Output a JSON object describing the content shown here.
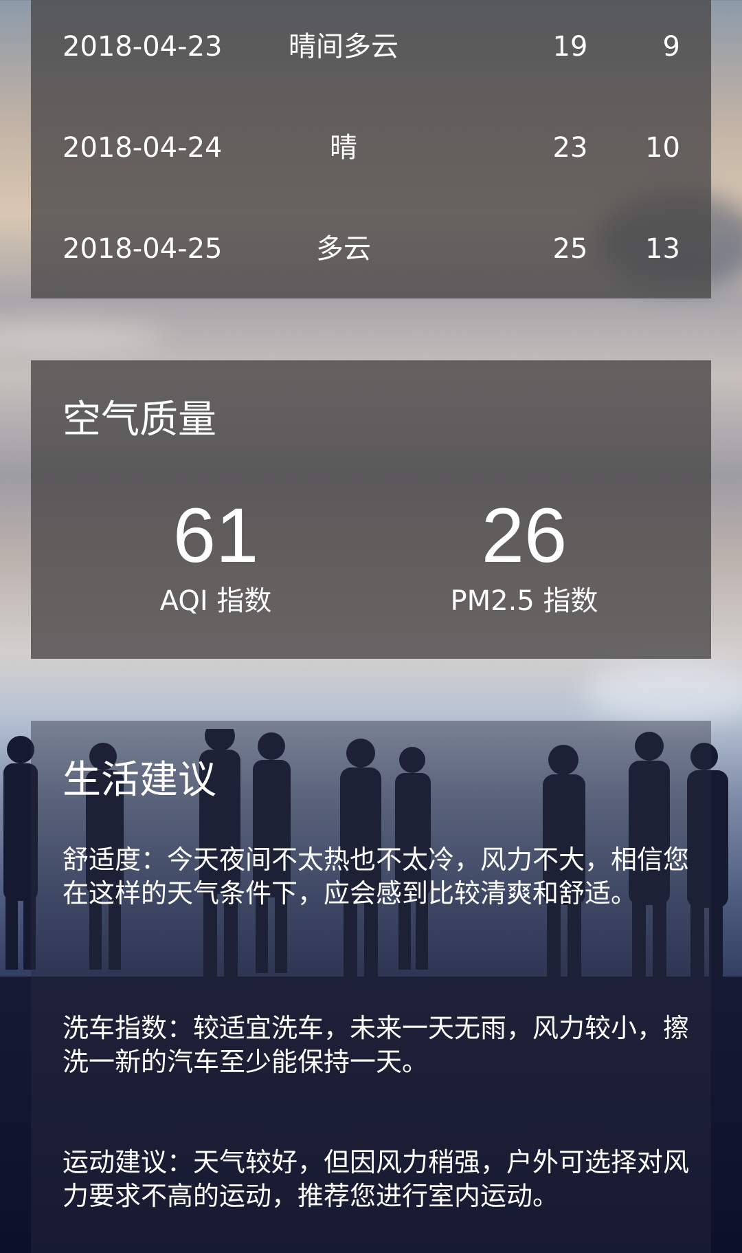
{
  "forecast": {
    "rows": [
      {
        "date": "2018-04-23",
        "condition": "晴间多云",
        "max": "19",
        "min": "9"
      },
      {
        "date": "2018-04-24",
        "condition": "晴",
        "max": "23",
        "min": "10"
      },
      {
        "date": "2018-04-25",
        "condition": "多云",
        "max": "25",
        "min": "13"
      }
    ]
  },
  "air_quality": {
    "title": "空气质量",
    "aqi": {
      "value": "61",
      "label": "AQI 指数"
    },
    "pm25": {
      "value": "26",
      "label": "PM2.5 指数"
    }
  },
  "suggestion": {
    "title": "生活建议",
    "comfort": "舒适度：今天夜间不太热也不太冷，风力不大，相信您在这样的天气条件下，应会感到比较清爽和舒适。",
    "car_wash": "洗车指数：较适宜洗车，未来一天无雨，风力较小，擦洗一新的汽车至少能保持一天。",
    "sport": "运动建议：天气较好，但因风力稍强，户外可选择对风力要求不高的运动，推荐您进行室内运动。"
  }
}
